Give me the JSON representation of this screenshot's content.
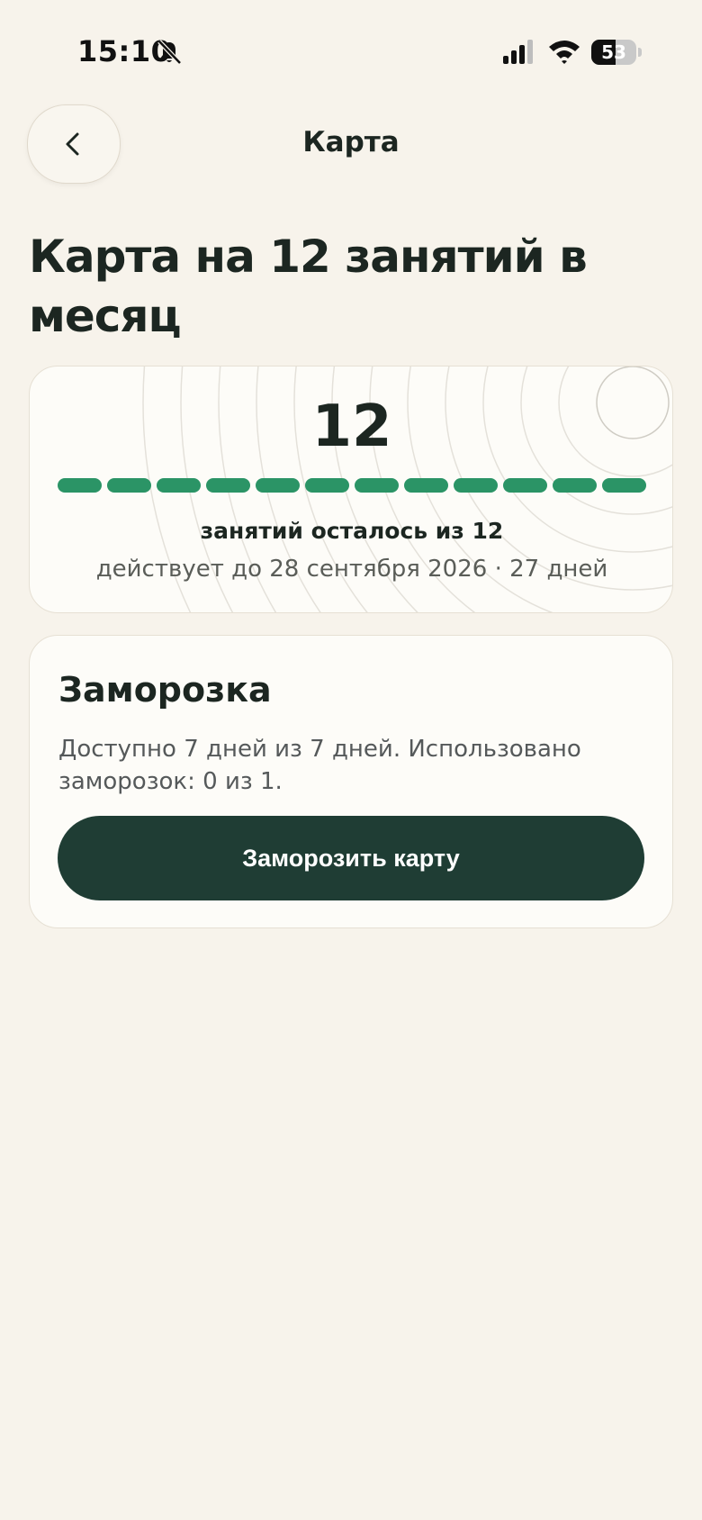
{
  "status_bar": {
    "time": "15:10",
    "battery_level": "53",
    "battery_fraction": 0.53,
    "icons": [
      "bell-slash-icon",
      "cellular-signal-icon",
      "wifi-icon",
      "battery-icon"
    ]
  },
  "nav": {
    "back_icon": "chevron-left-icon",
    "title": "Карта"
  },
  "page": {
    "title": "Карта на 12 занятий в месяц"
  },
  "balance": {
    "remaining": "12",
    "total": 12,
    "remaining_count": 12,
    "caption": "занятий осталось из 12",
    "valid_until": "действует до 28 сентября 2026 · 27 дней"
  },
  "freeze": {
    "title": "Заморозка",
    "description": "Доступно 7 дней из 7 дней. Использовано заморозок: 0 из 1.",
    "button_label": "Заморозить карту"
  },
  "colors": {
    "background": "#f7f3eb",
    "card": "#fdfcf8",
    "accent_green": "#2b9466",
    "button_dark": "#1f3d34",
    "text_primary": "#1c2621",
    "text_secondary": "#55595a"
  }
}
